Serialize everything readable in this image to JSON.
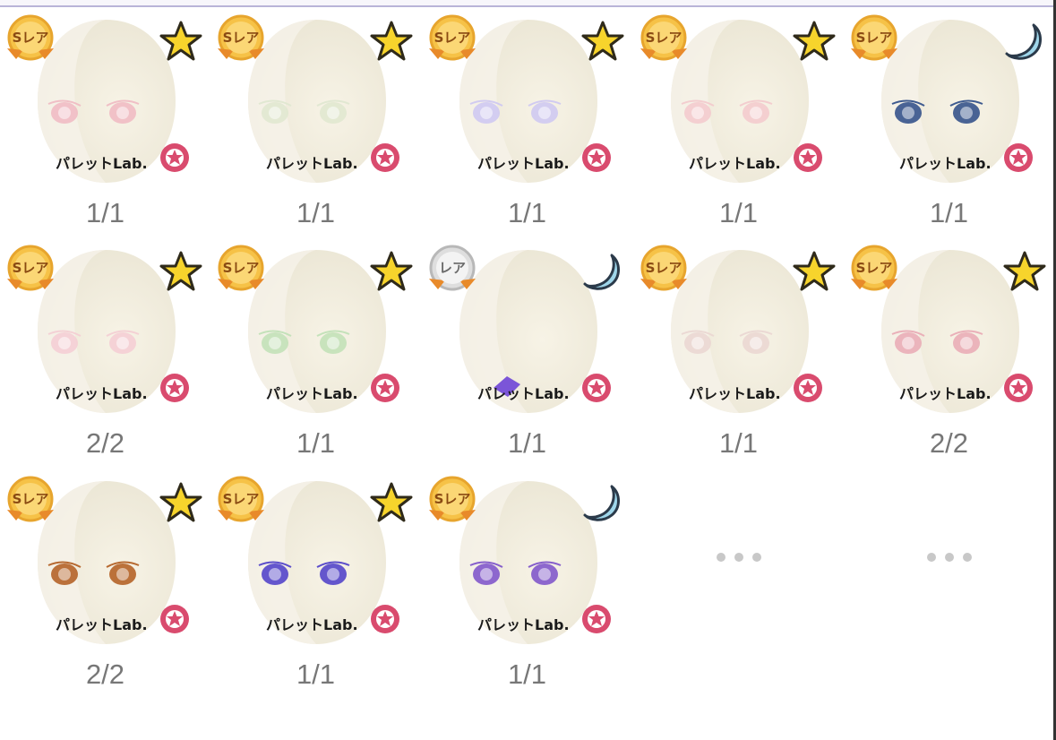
{
  "grid": {
    "items": [
      {
        "rarity": "Sレア",
        "rarity_kind": "gold",
        "sym": "star-icon",
        "eye": "#f0b9c2",
        "brand": "パレットLab.",
        "count": "1/1"
      },
      {
        "rarity": "Sレア",
        "rarity_kind": "gold",
        "sym": "star-icon",
        "eye": "#dfe7cf",
        "brand": "パレットLab.",
        "count": "1/1"
      },
      {
        "rarity": "Sレア",
        "rarity_kind": "gold",
        "sym": "star-icon",
        "eye": "#cdc7f2",
        "brand": "パレットLab.",
        "count": "1/1"
      },
      {
        "rarity": "Sレア",
        "rarity_kind": "gold",
        "sym": "star-icon",
        "eye": "#f3c9cc",
        "brand": "パレットLab.",
        "count": "1/1"
      },
      {
        "rarity": "Sレア",
        "rarity_kind": "gold",
        "sym": "moon-icon",
        "eye": "#2a4a86",
        "brand": "パレットLab.",
        "count": "1/1"
      },
      {
        "rarity": "Sレア",
        "rarity_kind": "gold",
        "sym": "star-icon",
        "eye": "#f4cdd3",
        "brand": "パレットLab.",
        "count": "2/2"
      },
      {
        "rarity": "Sレア",
        "rarity_kind": "gold",
        "sym": "star-icon",
        "eye": "#bfe0b5",
        "brand": "パレットLab.",
        "count": "1/1"
      },
      {
        "rarity": "レア",
        "rarity_kind": "silver",
        "sym": "moon-icon",
        "eye": "",
        "brand": "パレットLab.",
        "count": "1/1"
      },
      {
        "rarity": "Sレア",
        "rarity_kind": "gold",
        "sym": "star-icon",
        "eye": "#ead6d1",
        "brand": "パレットLab.",
        "count": "1/1"
      },
      {
        "rarity": "Sレア",
        "rarity_kind": "gold",
        "sym": "star-icon",
        "eye": "#e9a9b4",
        "brand": "パレットLab.",
        "count": "2/2"
      },
      {
        "rarity": "Sレア",
        "rarity_kind": "gold",
        "sym": "star-icon",
        "eye": "#b05a1c",
        "brand": "パレットLab.",
        "count": "2/2"
      },
      {
        "rarity": "Sレア",
        "rarity_kind": "gold",
        "sym": "star-icon",
        "eye": "#4a3bc8",
        "brand": "パレットLab.",
        "count": "1/1"
      },
      {
        "rarity": "Sレア",
        "rarity_kind": "gold",
        "sym": "moon-icon",
        "eye": "#7a4fc9",
        "brand": "パレットLab.",
        "count": "1/1"
      }
    ]
  }
}
